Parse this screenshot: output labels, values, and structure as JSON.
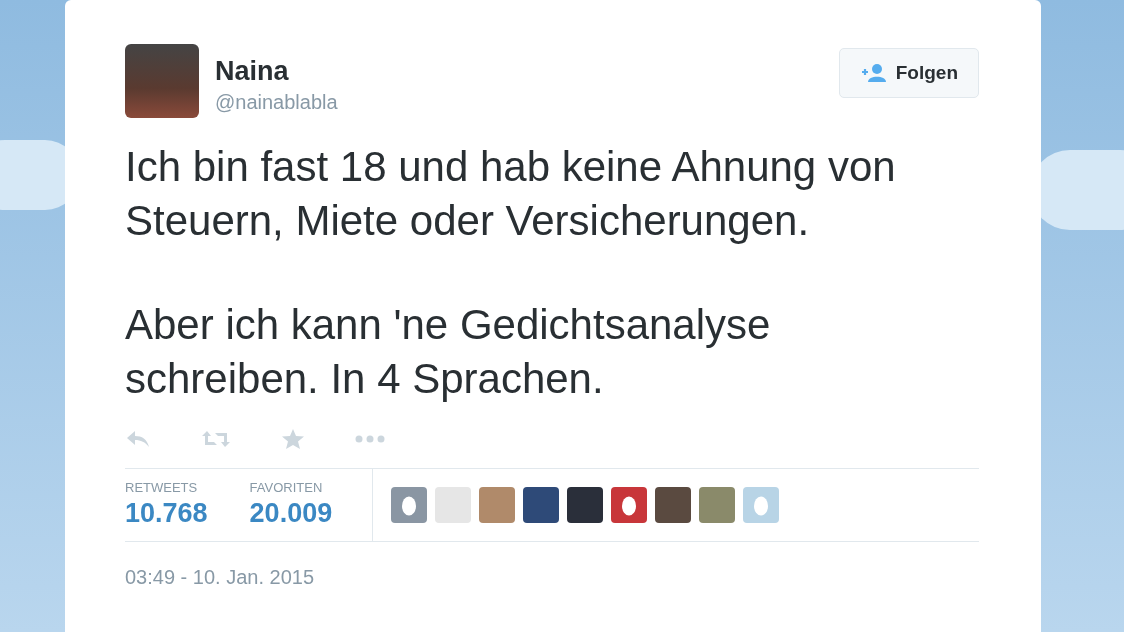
{
  "user": {
    "name": "Naina",
    "handle": "@nainablabla"
  },
  "follow_button": {
    "label": "Folgen"
  },
  "tweet": {
    "paragraphs": [
      "Ich bin fast 18 und hab keine Ahnung von Steuern, Miete oder Versicherungen.",
      "Aber ich kann 'ne Gedichtsanalyse schreiben. In 4 Sprachen."
    ]
  },
  "stats": [
    {
      "label": "RETWEETS",
      "value": "10.768"
    },
    {
      "label": "FAVORITEN",
      "value": "20.009"
    }
  ],
  "favorited_by": [
    {
      "kind": "egg",
      "color": "#8a96a3"
    },
    {
      "kind": "photo",
      "color": "#e6e6e6"
    },
    {
      "kind": "photo",
      "color": "#b08a6a"
    },
    {
      "kind": "photo",
      "color": "#2e4a78"
    },
    {
      "kind": "photo",
      "color": "#2a2f3a"
    },
    {
      "kind": "egg",
      "color": "#c8363a"
    },
    {
      "kind": "photo",
      "color": "#5a4a40"
    },
    {
      "kind": "photo",
      "color": "#8a8a6a"
    },
    {
      "kind": "egg",
      "color": "#b8d4e6"
    }
  ],
  "timestamp": "03:49 - 10. Jan. 2015"
}
